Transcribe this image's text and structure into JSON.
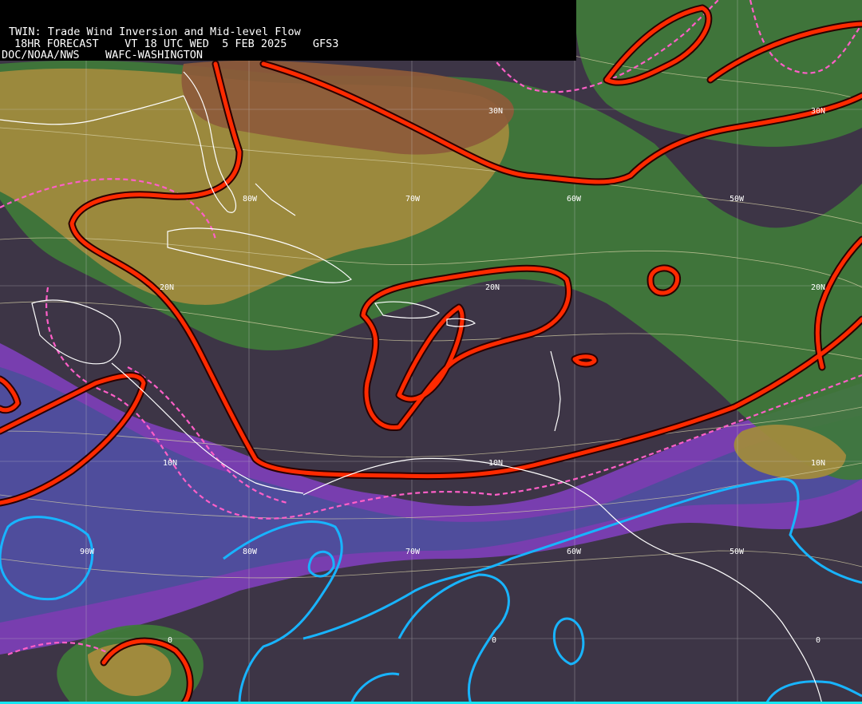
{
  "header": {
    "title": "TWIN: Trade Wind Inversion and Mid-level Flow",
    "forecast_line": "18HR FORECAST    VT 18 UTC WED  5 FEB 2025    GFS3",
    "agency_line": "DOC/NOAA/NWS    WAFC-WASHINGTON"
  },
  "grid_labels": {
    "lat_30n": "30N",
    "lat_20n": "20N",
    "lat_10n": "10N",
    "lat_0": "0",
    "lon_90w": "90W",
    "lon_80w": "80W",
    "lon_70w": "70W",
    "lon_60w": "60W",
    "lon_50w": "50W"
  },
  "colors": {
    "background": "#3d3546",
    "purple_band": "#7b3fb5",
    "blue_band": "#4a4f9a",
    "green_band": "#3f7a3a",
    "tan_band": "#a08a3d",
    "brown_band": "#8d5a3a",
    "red_contour": "#ff2a00",
    "pink_dashed": "#ff5fc8",
    "cyan_contour": "#18b4ff",
    "coastline": "#ffffff",
    "streamline": "#d9d3a8",
    "grid": "#c8c8c8"
  }
}
